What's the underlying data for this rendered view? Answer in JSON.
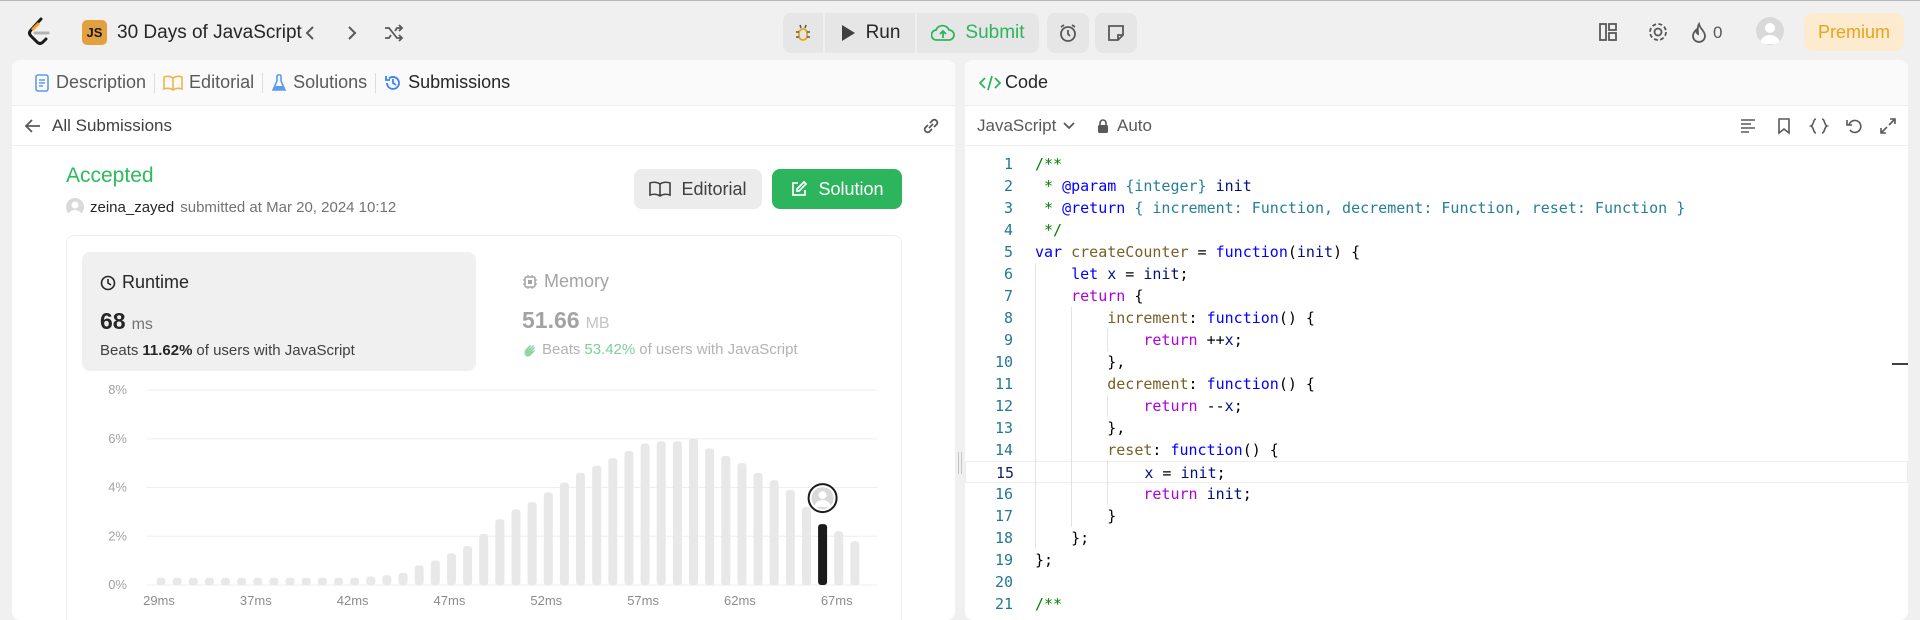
{
  "header": {
    "problem_title": "30 Days of JavaScript",
    "badge": "JS",
    "run_label": "Run",
    "submit_label": "Submit",
    "streak_count": "0",
    "premium_label": "Premium"
  },
  "left_tabs": [
    "Description",
    "Editorial",
    "Solutions",
    "Submissions"
  ],
  "all_submissions_label": "All Submissions",
  "submission": {
    "status": "Accepted",
    "user": "zeina_zayed",
    "submitted_text": "submitted at Mar 20, 2024 10:12",
    "editorial_btn": "Editorial",
    "solution_btn": "Solution"
  },
  "runtime": {
    "label": "Runtime",
    "value": "68",
    "unit": "ms",
    "beats_prefix": "Beats",
    "beats_pct": "11.62%",
    "beats_suffix": "of users with JavaScript"
  },
  "memory": {
    "label": "Memory",
    "value": "51.66",
    "unit": "MB",
    "beats_prefix": "Beats",
    "beats_pct": "53.42%",
    "beats_suffix": "of users with JavaScript"
  },
  "chart_data": {
    "type": "bar",
    "ylim": [
      0,
      8
    ],
    "ytick_labels": [
      "8%",
      "6%",
      "4%",
      "2%",
      "0%"
    ],
    "xtick_labels": [
      "29ms",
      "37ms",
      "42ms",
      "47ms",
      "52ms",
      "57ms",
      "62ms",
      "67ms"
    ],
    "values": [
      0.3,
      0.3,
      0.3,
      0.3,
      0.3,
      0.3,
      0.3,
      0.3,
      0.3,
      0.3,
      0.3,
      0.3,
      0.3,
      0.35,
      0.4,
      0.5,
      0.8,
      1.0,
      1.3,
      1.6,
      2.1,
      2.7,
      3.1,
      3.4,
      3.8,
      4.2,
      4.6,
      4.9,
      5.2,
      5.5,
      5.8,
      5.9,
      5.9,
      6.0,
      5.6,
      5.3,
      5.0,
      4.6,
      4.3,
      3.9,
      3.2,
      2.5,
      2.2,
      1.8
    ],
    "highlight_index": 41,
    "colors": {
      "bar": "#e8e8e8",
      "highlight": "#1a1a1a",
      "grid": "#eeeeee"
    }
  },
  "right_panel": {
    "tab_label": "Code",
    "language": "JavaScript",
    "mode": "Auto"
  },
  "code_lines": [
    [
      [
        "c-com",
        "/**"
      ]
    ],
    [
      [
        "c-com",
        " * "
      ],
      [
        "c-tag",
        "@param"
      ],
      [
        "c-com",
        " "
      ],
      [
        "c-typ",
        "{integer}"
      ],
      [
        "c-com",
        " "
      ],
      [
        "c-var",
        "init"
      ]
    ],
    [
      [
        "c-com",
        " * "
      ],
      [
        "c-tag",
        "@return"
      ],
      [
        "c-com",
        " "
      ],
      [
        "c-typ",
        "{ increment: Function, decrement: Function, reset: Function }"
      ]
    ],
    [
      [
        "c-com",
        " */"
      ]
    ],
    [
      [
        "c-key",
        "var"
      ],
      [
        "c-txt",
        " "
      ],
      [
        "c-fn",
        "createCounter"
      ],
      [
        "c-txt",
        " = "
      ],
      [
        "c-key",
        "function"
      ],
      [
        "c-txt",
        "("
      ],
      [
        "c-var",
        "init"
      ],
      [
        "c-txt",
        ") {"
      ]
    ],
    [
      [
        "c-txt",
        "    "
      ],
      [
        "c-key",
        "let"
      ],
      [
        "c-txt",
        " "
      ],
      [
        "c-var",
        "x"
      ],
      [
        "c-txt",
        " = "
      ],
      [
        "c-var",
        "init"
      ],
      [
        "c-txt",
        ";"
      ]
    ],
    [
      [
        "c-txt",
        "    "
      ],
      [
        "c-ctl",
        "return"
      ],
      [
        "c-txt",
        " {"
      ]
    ],
    [
      [
        "c-txt",
        "        "
      ],
      [
        "c-fn",
        "increment"
      ],
      [
        "c-txt",
        ": "
      ],
      [
        "c-key",
        "function"
      ],
      [
        "c-txt",
        "() {"
      ]
    ],
    [
      [
        "c-txt",
        "            "
      ],
      [
        "c-ctl",
        "return"
      ],
      [
        "c-txt",
        " ++"
      ],
      [
        "c-var",
        "x"
      ],
      [
        "c-txt",
        ";"
      ]
    ],
    [
      [
        "c-txt",
        "        },"
      ]
    ],
    [
      [
        "c-txt",
        "        "
      ],
      [
        "c-fn",
        "decrement"
      ],
      [
        "c-txt",
        ": "
      ],
      [
        "c-key",
        "function"
      ],
      [
        "c-txt",
        "() {"
      ]
    ],
    [
      [
        "c-txt",
        "            "
      ],
      [
        "c-ctl",
        "return"
      ],
      [
        "c-txt",
        " --"
      ],
      [
        "c-var",
        "x"
      ],
      [
        "c-txt",
        ";"
      ]
    ],
    [
      [
        "c-txt",
        "        },"
      ]
    ],
    [
      [
        "c-txt",
        "        "
      ],
      [
        "c-fn",
        "reset"
      ],
      [
        "c-txt",
        ": "
      ],
      [
        "c-key",
        "function"
      ],
      [
        "c-txt",
        "() {"
      ]
    ],
    [
      [
        "c-txt",
        "            "
      ],
      [
        "c-var",
        "x"
      ],
      [
        "c-txt",
        " = "
      ],
      [
        "c-var",
        "init"
      ],
      [
        "c-txt",
        ";"
      ]
    ],
    [
      [
        "c-txt",
        "            "
      ],
      [
        "c-ctl",
        "return"
      ],
      [
        "c-txt",
        " "
      ],
      [
        "c-var",
        "init"
      ],
      [
        "c-txt",
        ";"
      ]
    ],
    [
      [
        "c-txt",
        "        }"
      ]
    ],
    [
      [
        "c-txt",
        "    };"
      ]
    ],
    [
      [
        "c-txt",
        "};"
      ]
    ],
    [
      [
        "c-txt",
        ""
      ]
    ],
    [
      [
        "c-com",
        "/**"
      ]
    ]
  ]
}
